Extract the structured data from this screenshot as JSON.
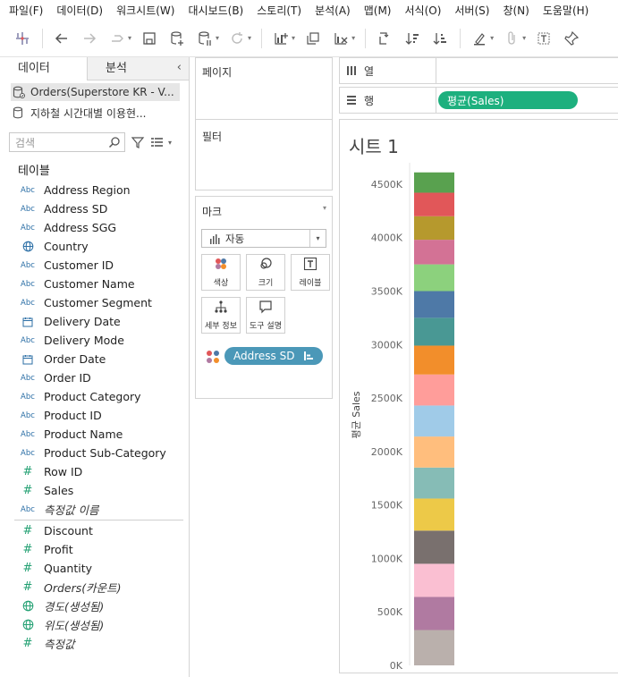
{
  "menu": [
    "파일(F)",
    "데이터(D)",
    "워크시트(W)",
    "대시보드(B)",
    "스토리(T)",
    "분석(A)",
    "맵(M)",
    "서식(O)",
    "서버(S)",
    "창(N)",
    "도움말(H)"
  ],
  "data_pane": {
    "tab_data": "데이터",
    "tab_analysis": "분석",
    "sources": [
      {
        "label": "Orders(Superstore KR - V...",
        "selected": true
      },
      {
        "label": "지하철 시간대별 이용현...",
        "selected": false
      }
    ],
    "search_placeholder": "검색",
    "tables_header": "테이블",
    "dimensions": [
      {
        "type": "Abc",
        "label": "Address Region",
        "italic": false
      },
      {
        "type": "Abc",
        "label": "Address SD",
        "italic": false
      },
      {
        "type": "Abc",
        "label": "Address SGG",
        "italic": false
      },
      {
        "type": "globe",
        "label": "Country",
        "italic": false
      },
      {
        "type": "Abc",
        "label": "Customer ID",
        "italic": false
      },
      {
        "type": "Abc",
        "label": "Customer Name",
        "italic": false
      },
      {
        "type": "Abc",
        "label": "Customer Segment",
        "italic": false
      },
      {
        "type": "date",
        "label": "Delivery Date",
        "italic": false
      },
      {
        "type": "Abc",
        "label": "Delivery Mode",
        "italic": false
      },
      {
        "type": "date",
        "label": "Order Date",
        "italic": false
      },
      {
        "type": "Abc",
        "label": "Order ID",
        "italic": false
      },
      {
        "type": "Abc",
        "label": "Product Category",
        "italic": false
      },
      {
        "type": "Abc",
        "label": "Product ID",
        "italic": false
      },
      {
        "type": "Abc",
        "label": "Product Name",
        "italic": false
      },
      {
        "type": "Abc",
        "label": "Product Sub-Category",
        "italic": false
      },
      {
        "type": "#",
        "label": "Row ID",
        "italic": false
      },
      {
        "type": "#",
        "label": "Sales",
        "italic": false
      },
      {
        "type": "Abc",
        "label": "측정값 이름",
        "italic": true
      }
    ],
    "measures": [
      {
        "type": "#",
        "label": "Discount",
        "italic": false
      },
      {
        "type": "#",
        "label": "Profit",
        "italic": false
      },
      {
        "type": "#",
        "label": "Quantity",
        "italic": false
      },
      {
        "type": "#",
        "label": "Orders(카운트)",
        "italic": true
      },
      {
        "type": "globe",
        "label": "경도(생성됨)",
        "italic": true
      },
      {
        "type": "globe",
        "label": "위도(생성됨)",
        "italic": true
      },
      {
        "type": "#",
        "label": "측정값",
        "italic": true
      }
    ]
  },
  "pages_card": {
    "title": "페이지"
  },
  "filters_card": {
    "title": "필터"
  },
  "marks_card": {
    "title": "마크",
    "mark_type": "자동",
    "buttons": {
      "color": "색상",
      "size": "크기",
      "label": "레이블",
      "detail": "세부 정보",
      "tooltip": "도구 설명"
    },
    "pill": "Address SD"
  },
  "shelves": {
    "columns_label": "열",
    "rows_label": "행",
    "rows_pill": "평균(Sales)"
  },
  "sheet": {
    "title": "시트 1"
  },
  "chart_data": {
    "type": "bar",
    "stacked": true,
    "ylabel": "평균 Sales",
    "ylim": [
      0,
      4700000
    ],
    "yticks": [
      0,
      500000,
      1000000,
      1500000,
      2000000,
      2500000,
      3000000,
      3500000,
      4000000,
      4500000
    ],
    "ytick_labels": [
      "0K",
      "500K",
      "1000K",
      "1500K",
      "2000K",
      "2500K",
      "3000K",
      "3500K",
      "4000K",
      "4500K"
    ],
    "segment_colors": [
      "#bab0ac",
      "#b07aa1",
      "#fabfd2",
      "#79706e",
      "#edc948",
      "#86bcb6",
      "#ffbe7d",
      "#a0cbe8",
      "#ff9d9a",
      "#f28e2b",
      "#499894",
      "#4e79a7",
      "#8cd17d",
      "#d37295",
      "#b6992d",
      "#e15759",
      "#59a14f"
    ],
    "segment_values": [
      330000,
      310000,
      310000,
      310000,
      300000,
      290000,
      290000,
      290000,
      290000,
      270000,
      260000,
      250000,
      250000,
      230000,
      220000,
      220000,
      190000
    ]
  }
}
